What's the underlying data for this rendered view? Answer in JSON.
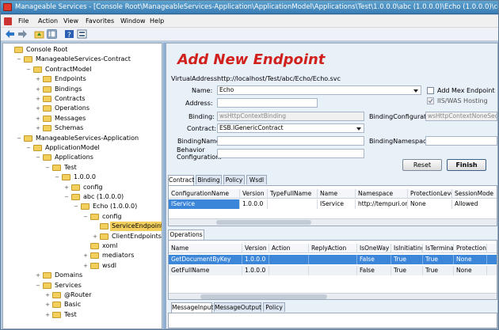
{
  "window": {
    "title": "Manageable Services - [Console Root\\ManageableServices-Application\\ApplicationModel\\Applications\\Test\\1.0.0.0\\abc (1.0.0.0)\\Echo (1.0.0.0)\\config..."
  },
  "menu": [
    "File",
    "Action",
    "View",
    "Favorites",
    "Window",
    "Help"
  ],
  "toolbar": [
    "back-icon",
    "forward-icon",
    "up-folder-icon",
    "show-tree-icon",
    "help-icon",
    "properties-icon"
  ],
  "tree": [
    {
      "label": "Console Root",
      "level": 0,
      "exp": ""
    },
    {
      "label": "ManageableServices-Contract",
      "level": 1,
      "exp": "−"
    },
    {
      "label": "ContractModel",
      "level": 2,
      "exp": "−"
    },
    {
      "label": "Endpoints",
      "level": 3,
      "exp": "+"
    },
    {
      "label": "Bindings",
      "level": 3,
      "exp": "+"
    },
    {
      "label": "Contracts",
      "level": 3,
      "exp": "+"
    },
    {
      "label": "Operations",
      "level": 3,
      "exp": "+"
    },
    {
      "label": "Messages",
      "level": 3,
      "exp": "+"
    },
    {
      "label": "Schemas",
      "level": 3,
      "exp": "+"
    },
    {
      "label": "ManageableServices-Application",
      "level": 1,
      "exp": "−"
    },
    {
      "label": "ApplicationModel",
      "level": 2,
      "exp": "−"
    },
    {
      "label": "Applications",
      "level": 3,
      "exp": "−"
    },
    {
      "label": "Test",
      "level": 4,
      "exp": "−"
    },
    {
      "label": "1.0.0.0",
      "level": 5,
      "exp": "−"
    },
    {
      "label": "config",
      "level": 6,
      "exp": "+"
    },
    {
      "label": "abc (1.0.0.0)",
      "level": 6,
      "exp": "−"
    },
    {
      "label": "Echo (1.0.0.0)",
      "level": 7,
      "exp": "−"
    },
    {
      "label": "config",
      "level": 8,
      "exp": "−"
    },
    {
      "label": "ServiceEndpoints",
      "level": 9,
      "exp": "",
      "selected": true
    },
    {
      "label": "ClientEndpoints",
      "level": 9,
      "exp": "+"
    },
    {
      "label": "xoml",
      "level": 8,
      "exp": ""
    },
    {
      "label": "mediators",
      "level": 8,
      "exp": "+"
    },
    {
      "label": "wsdl",
      "level": 8,
      "exp": "+"
    },
    {
      "label": "Domains",
      "level": 3,
      "exp": "+"
    },
    {
      "label": "Services",
      "level": 3,
      "exp": "−"
    },
    {
      "label": "@Router",
      "level": 4,
      "exp": "+"
    },
    {
      "label": "Basic",
      "level": 4,
      "exp": "+"
    },
    {
      "label": "Test",
      "level": 4,
      "exp": "+"
    }
  ],
  "form": {
    "heading": "Add New Endpoint",
    "virtual_address_label": "VirtualAddress:",
    "virtual_address_value": "http://localhost/Test/abc/Echo/Echo.svc",
    "name_label": "Name:",
    "name_value": "Echo",
    "address_label": "Address:",
    "address_value": "",
    "binding_label": "Binding:",
    "binding_value": "wsHttpContextBinding",
    "binding_config_label": "BindingConfiguration:",
    "binding_config_value": "wsHttpContextNoneSecurity",
    "contract_label": "Contract:",
    "contract_value": "ESB.IGenericContract",
    "binding_name_label": "BindingName:",
    "binding_name_value": "",
    "binding_namespace_label": "BindingNamespace:",
    "binding_namespace_value": "",
    "behavior_label_1": "Behavior",
    "behavior_label_2": "Configuration:",
    "behavior_value": "",
    "add_mex_label": "Add Mex Endpoint",
    "iis_was_label": "IIS/WAS Hosting",
    "reset_label": "Reset",
    "finish_label": "Finish"
  },
  "contract_tabs": [
    "Contract",
    "Binding",
    "Policy",
    "Wsdl"
  ],
  "contract_grid": {
    "columns": [
      "ConfigurationName",
      "Version",
      "TypeFullName",
      "Name",
      "Namespace",
      "ProtectionLevel",
      "SessionMode"
    ],
    "rows": [
      [
        "IService",
        "1.0.0.0",
        "",
        "IService",
        "http://tempuri.org/",
        "None",
        "Allowed"
      ]
    ]
  },
  "operations_tab": "Operations",
  "operations_grid": {
    "columns": [
      "Name",
      "Version",
      "Action",
      "ReplyAction",
      "IsOneWay",
      "IsInitiating",
      "IsTerminating",
      "ProtectionLevel"
    ],
    "rows": [
      [
        "GetDocumentByKey",
        "1.0.0.0",
        "",
        "",
        "False",
        "True",
        "True",
        "None"
      ],
      [
        "GetFullName",
        "1.0.0.0",
        "",
        "",
        "False",
        "True",
        "True",
        "None"
      ]
    ]
  },
  "message_tabs": [
    "MessageInput",
    "MessageOutput",
    "Policy"
  ],
  "colors": {
    "heading": "#d0211d",
    "selection": "#3b86d9",
    "folder": "#f3cf5e"
  }
}
